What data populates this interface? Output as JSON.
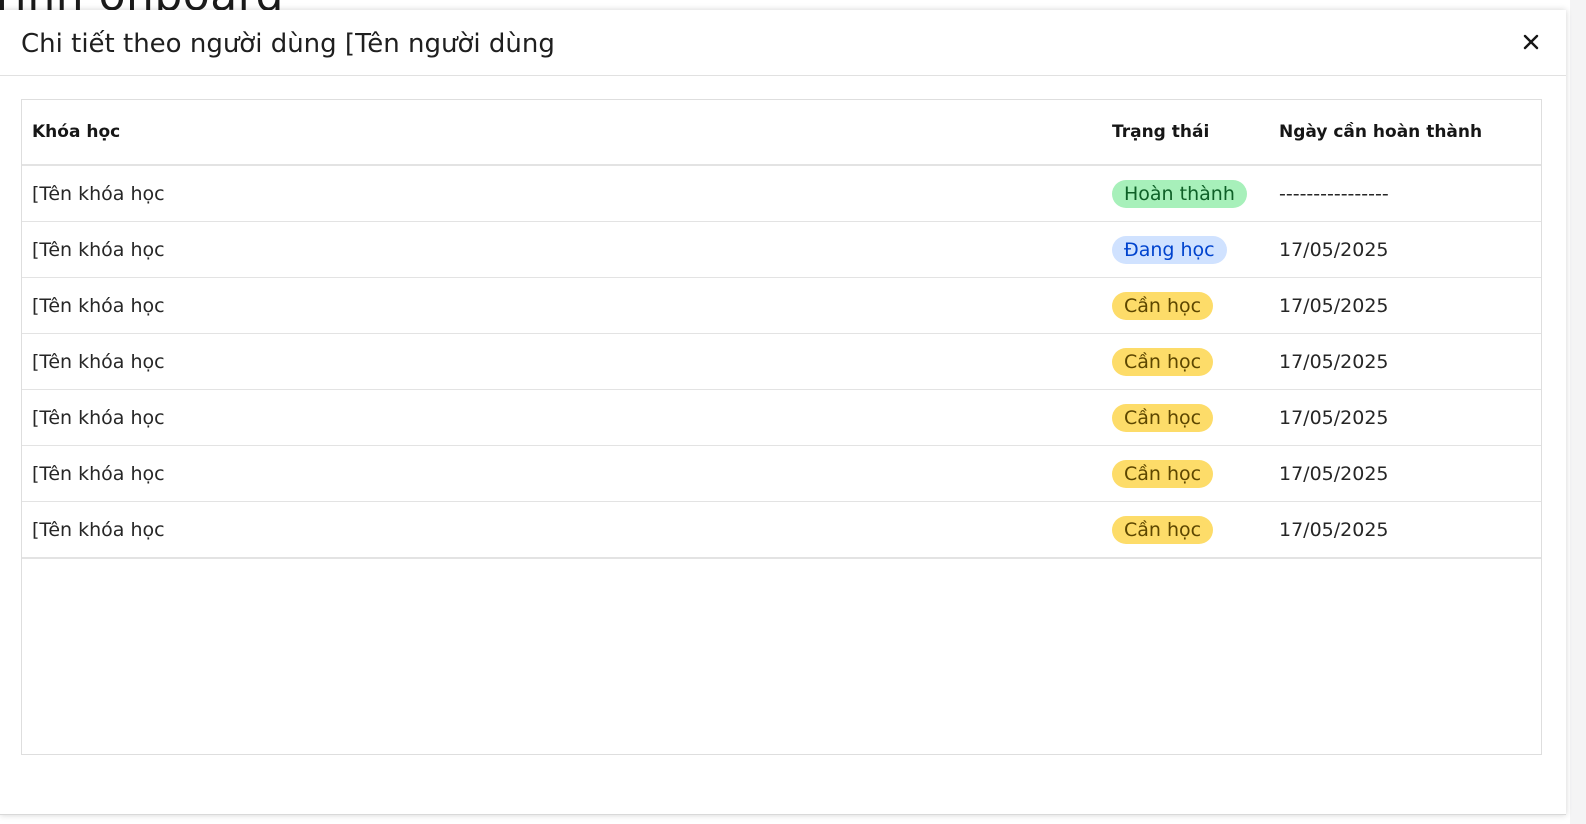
{
  "background": {
    "title_fragment": "rinh onboard"
  },
  "modal": {
    "title": "Chi tiết theo người dùng [Tên người dùng",
    "close_icon": "close-icon"
  },
  "table": {
    "headers": {
      "course": "Khóa học",
      "status": "Trạng thái",
      "due_date": "Ngày cần hoàn thành"
    },
    "rows": [
      {
        "course": "[Tên khóa học",
        "status": "Hoàn thành",
        "status_key": "done",
        "due_date": "----------------"
      },
      {
        "course": "[Tên khóa học",
        "status": "Đang học",
        "status_key": "in_progress",
        "due_date": "17/05/2025"
      },
      {
        "course": "[Tên khóa học",
        "status": "Cần học",
        "status_key": "todo",
        "due_date": "17/05/2025"
      },
      {
        "course": "[Tên khóa học",
        "status": "Cần học",
        "status_key": "todo",
        "due_date": "17/05/2025"
      },
      {
        "course": "[Tên khóa học",
        "status": "Cần học",
        "status_key": "todo",
        "due_date": "17/05/2025"
      },
      {
        "course": "[Tên khóa học",
        "status": "Cần học",
        "status_key": "todo",
        "due_date": "17/05/2025"
      },
      {
        "course": "[Tên khóa học",
        "status": "Cần học",
        "status_key": "todo",
        "due_date": "17/05/2025"
      }
    ]
  },
  "colors": {
    "done_bg": "#a7f0ba",
    "done_text": "#0e6027",
    "in_progress_bg": "#d0e2ff",
    "in_progress_text": "#0043ce",
    "todo_bg": "#fddc69",
    "todo_text": "#5c4600"
  }
}
